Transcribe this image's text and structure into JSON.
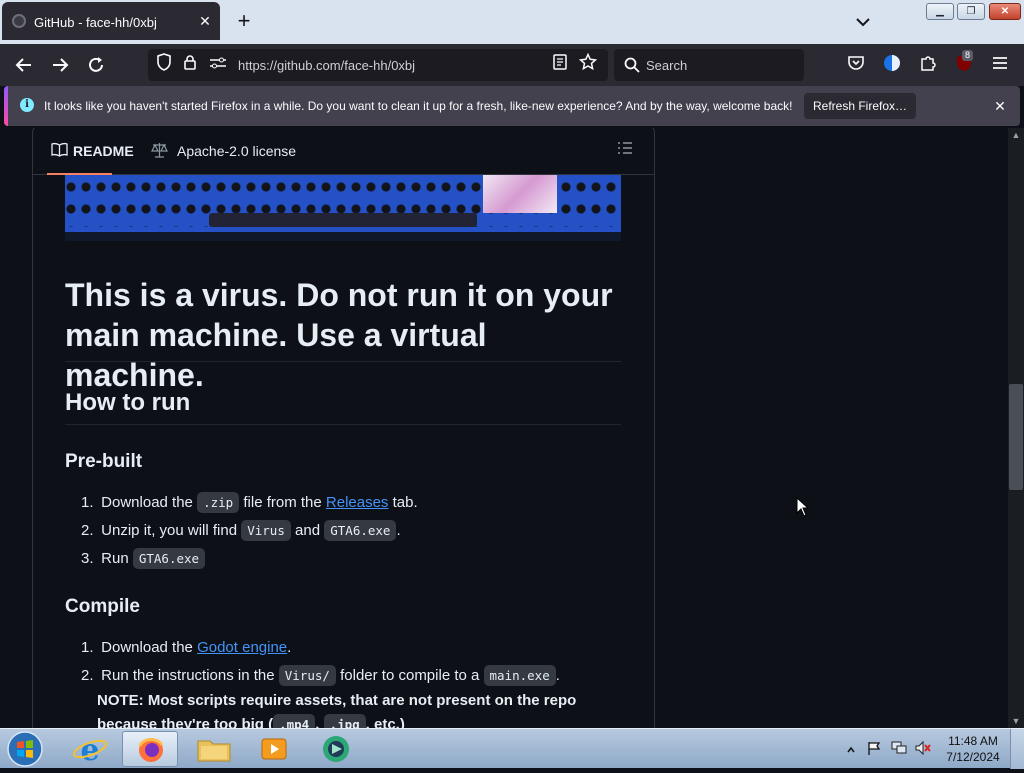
{
  "browser": {
    "tab_title": "GitHub - face-hh/0xbj",
    "url": "https://github.com/face-hh/0xbj",
    "search_placeholder": "Search",
    "extension_badge": "8"
  },
  "notification": {
    "message": "It looks like you haven't started Firefox in a while. Do you want to clean it up for a fresh, like-new experience? And by the way, welcome back!",
    "button": "Refresh Firefox…"
  },
  "readme": {
    "tabs": {
      "readme": "README",
      "license": "Apache-2.0 license"
    },
    "h1": "This is a virus. Do not run it on your main machine. Use a virtual machine.",
    "h2": "How to run",
    "prebuilt": {
      "heading": "Pre-built",
      "steps": [
        {
          "num": "1.",
          "a": "Download the ",
          "code": ".zip",
          "b": " file from the ",
          "link": "Releases",
          "c": " tab."
        },
        {
          "num": "2.",
          "a": "Unzip it, you will find ",
          "code1": "Virus",
          "b": " and ",
          "code2": "GTA6.exe",
          "c": "."
        },
        {
          "num": "3.",
          "a": "Run ",
          "code": "GTA6.exe"
        }
      ]
    },
    "compile": {
      "heading": "Compile",
      "steps": [
        {
          "num": "1.",
          "a": "Download the ",
          "link": "Godot engine",
          "b": "."
        },
        {
          "num": "2.",
          "a": "Run the instructions in the ",
          "code1": "Virus/",
          "b": " folder to compile to a ",
          "code2": "main.exe",
          "c": "."
        }
      ],
      "note": "NOTE: Most scripts require assets, that are not present on the repo because they're too big (",
      "note_code1": ".mp4",
      "note_sep": ", ",
      "note_code2": ".jpg",
      "note_end": ", etc.)"
    }
  },
  "taskbar": {
    "time": "11:48 AM",
    "date": "7/12/2024"
  },
  "colors": {
    "page_bg": "#0d1117",
    "link": "#4493f8",
    "tab_underline": "#f78166",
    "firefox_chrome": "#2b2a33"
  }
}
